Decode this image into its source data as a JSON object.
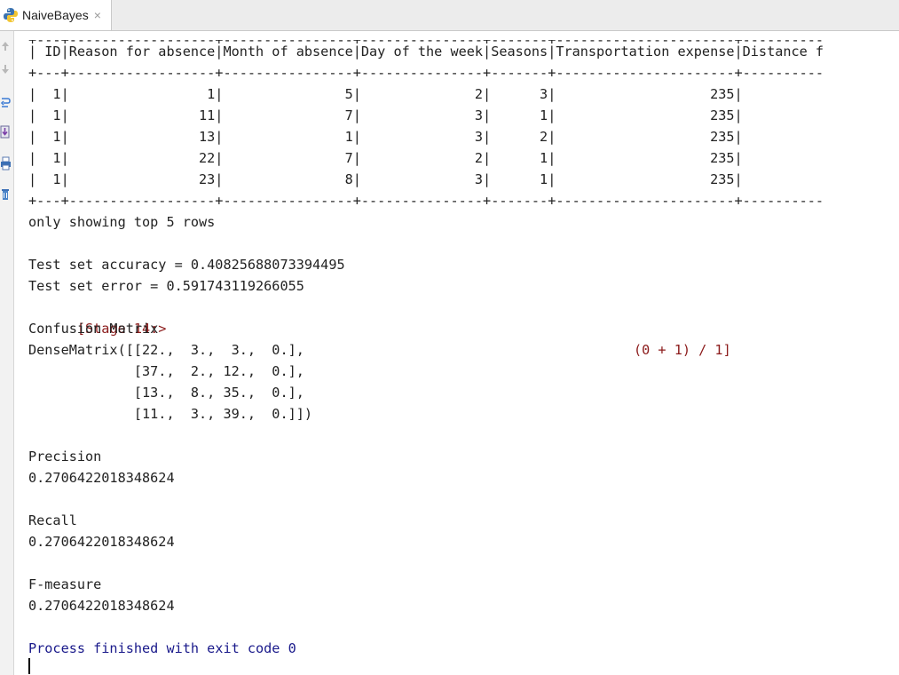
{
  "tab": {
    "label": "NaiveBayes",
    "close": "×",
    "icon": "python-icon"
  },
  "gutter": {
    "icons": [
      "up-arrow-icon",
      "down-arrow-icon",
      "wrap-icon",
      "scroll-end-icon",
      "print-icon",
      "trash-icon"
    ]
  },
  "console": {
    "lines": [
      "+---+------------------+----------------+---------------+-------+----------------------+----------",
      "| ID|Reason for absence|Month of absence|Day of the week|Seasons|Transportation expense|Distance f",
      "+---+------------------+----------------+---------------+-------+----------------------+----------",
      "|  1|                 1|               5|              2|      3|                   235|",
      "|  1|                11|               7|              3|      1|                   235|",
      "|  1|                13|               1|              3|      2|                   235|",
      "|  1|                22|               7|              2|      1|                   235|",
      "|  1|                23|               8|              3|      1|                   235|",
      "+---+------------------+----------------+---------------+-------+----------------------+----------",
      "only showing top 5 rows",
      "",
      "Test set accuracy = 0.40825688073394495",
      "Test set error = 0.591743119266055"
    ],
    "stage": "[Stage 14:>",
    "stage_progress": "(0 + 1) / 1]",
    "lines_after": [
      "Confusion Matrix",
      "DenseMatrix([[22.,  3.,  3.,  0.],",
      "             [37.,  2., 12.,  0.],",
      "             [13.,  8., 35.,  0.],",
      "             [11.,  3., 39.,  0.]])",
      "",
      "Precision",
      "0.2706422018348624",
      "",
      "Recall",
      "0.2706422018348624",
      "",
      "F-measure",
      "0.2706422018348624",
      ""
    ],
    "finish": "Process finished with exit code 0"
  },
  "colors": {
    "stage": "#8b1a1a",
    "finish": "#1a1a8b",
    "text": "#222222"
  }
}
